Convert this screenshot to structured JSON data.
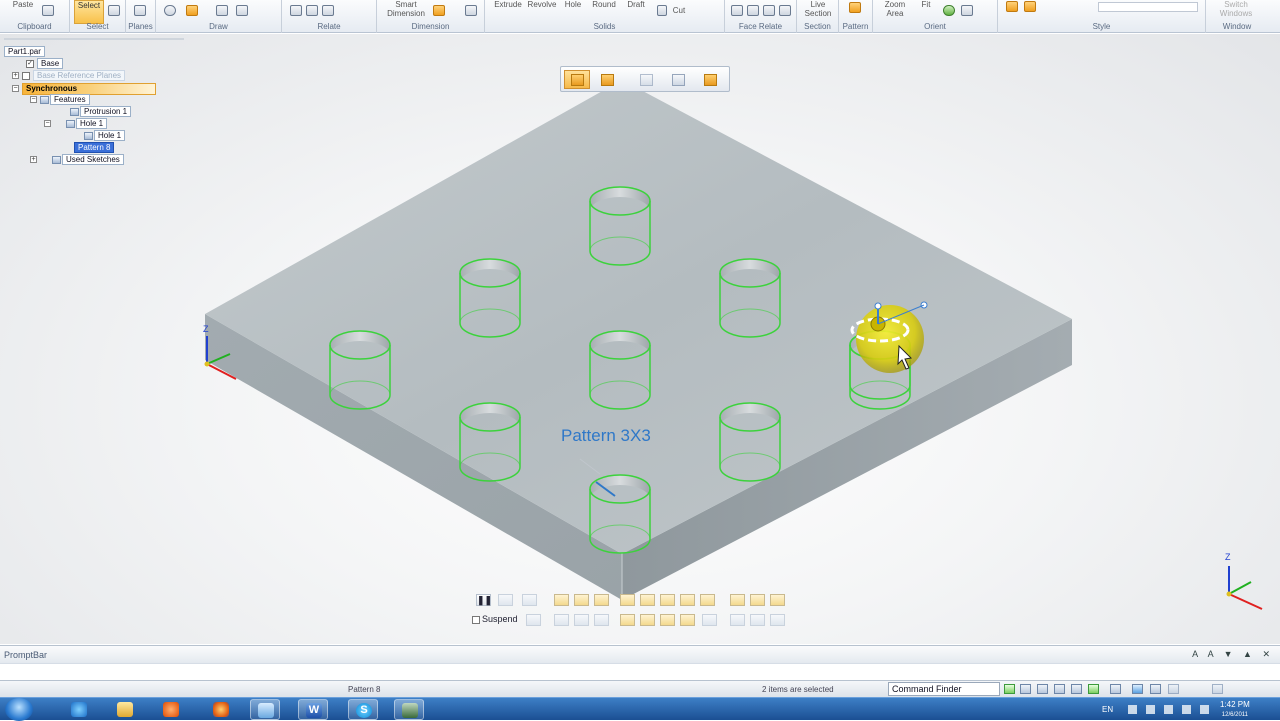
{
  "ribbon": {
    "buttons": {
      "paste": "Paste",
      "select": "Select",
      "smart_dimension": "Smart\nDimension",
      "extrude": "Extrude",
      "revolve": "Revolve",
      "hole": "Hole",
      "round": "Round",
      "draft": "Draft",
      "cut": "Cut",
      "live_section": "Live\nSection",
      "zoom_area": "Zoom\nArea",
      "fit": "Fit",
      "switch_windows": "Switch\nWindows"
    },
    "groups": [
      "Clipboard",
      "Select",
      "Planes",
      "Draw",
      "Relate",
      "Dimension",
      "Solids",
      "Face Relate",
      "Section",
      "Pattern",
      "Orient",
      "Style",
      "Window"
    ]
  },
  "tree": {
    "part": "Part1.par",
    "base": "Base",
    "base_ref_planes": "Base Reference Planes",
    "synchronous": "Synchronous",
    "features": "Features",
    "protrusion": "Protrusion 1",
    "hole_group": "Hole 1",
    "hole_item": "Hole 1",
    "pattern": "Pattern 8",
    "used_sketches": "Used Sketches"
  },
  "viewport": {
    "pattern_label": "Pattern 3X3",
    "axis_z": "Z"
  },
  "quickbar": {
    "suspend": "Suspend"
  },
  "promptbar": {
    "title": "PromptBar"
  },
  "statusbar": {
    "left": "Pattern 8",
    "selection": "2 items are selected",
    "command_finder": "Command Finder"
  },
  "taskbar": {
    "lang": "EN",
    "time": "1:42 PM",
    "date": "12/6/2011"
  },
  "colors": {
    "accent_orange": "#f6b94a",
    "hole_green": "#3cd23c",
    "label_blue": "#2f78c8",
    "selection_blue": "#3a6fd8",
    "taskbar_blue": "#1b4f93"
  }
}
